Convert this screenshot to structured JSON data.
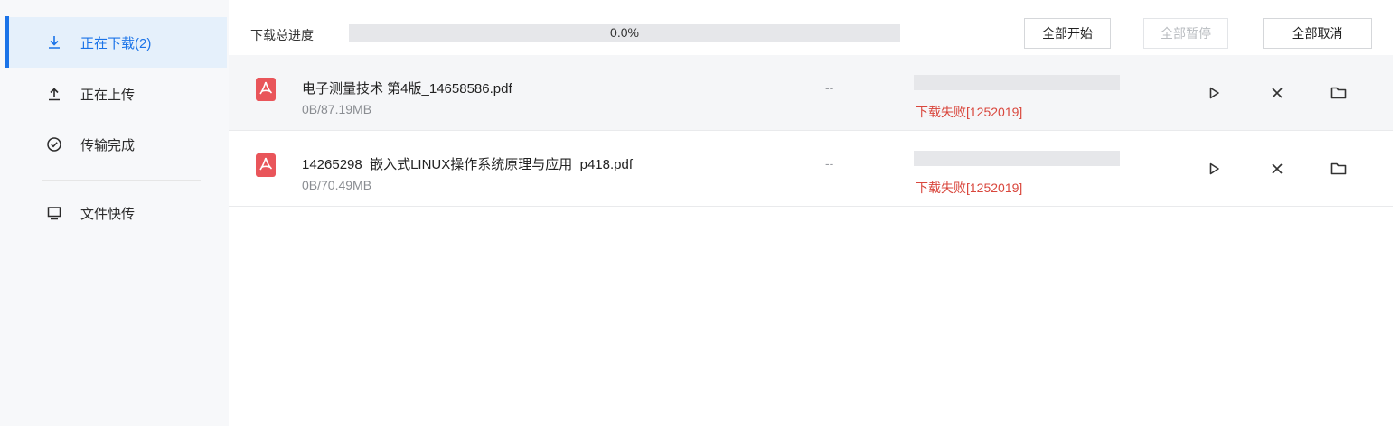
{
  "sidebar": {
    "items": [
      {
        "label": "正在下载(2)",
        "icon": "download-icon",
        "active": true
      },
      {
        "label": "正在上传",
        "icon": "upload-icon"
      },
      {
        "label": "传输完成",
        "icon": "check-circle-icon"
      },
      {
        "label": "文件快传",
        "icon": "monitor-icon"
      }
    ]
  },
  "toolbar": {
    "progress_label": "下载总进度",
    "progress_value": "0.0%",
    "progress_fraction": 0.0,
    "start_all": "全部开始",
    "pause_all": "全部暂停",
    "cancel_all": "全部取消"
  },
  "downloads": [
    {
      "name": "电子测量技术  第4版_14658586.pdf",
      "size": "0B/87.19MB",
      "speed": "--",
      "status": "下载失败[1252019]",
      "progress": 0
    },
    {
      "name": "14265298_嵌入式LINUX操作系统原理与应用_p418.pdf",
      "size": "0B/70.49MB",
      "speed": "--",
      "status": "下载失败[1252019]",
      "progress": 0
    }
  ],
  "colors": {
    "accent": "#1a73e8",
    "error": "#d9473d",
    "pdf": "#e9555a"
  }
}
